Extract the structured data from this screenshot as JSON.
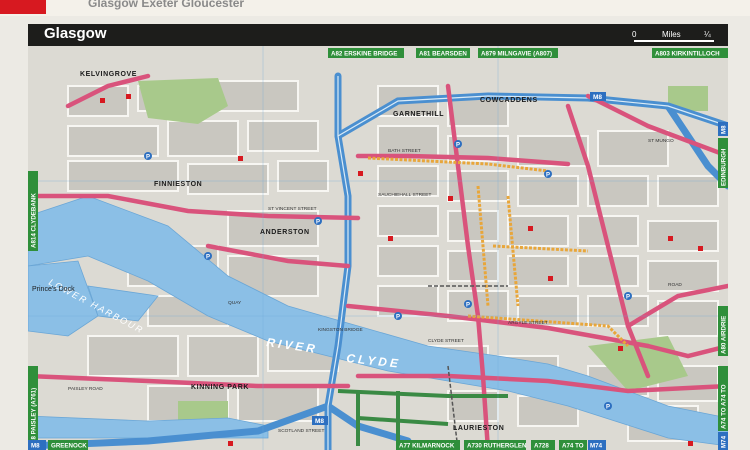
{
  "header": {
    "book_title": "Glasgow  Exeter  Gloucester",
    "map_title": "Glasgow"
  },
  "scale_bar": {
    "zero": "0",
    "unit": "Miles",
    "quarter": "¼"
  },
  "route_signs": {
    "top": [
      "A82 ERSKINE BRIDGE",
      "A81 BEARSDEN",
      "A879 MILNGAVIE (A807)",
      "A803 KIRKINTILLOCH"
    ],
    "bottom": [
      "M8",
      "GREENOCK",
      "A77 KILMARNOCK",
      "A730 RUTHERGLEN",
      "A728",
      "A74 TO",
      "M74"
    ],
    "left": [
      "A814 CLYDEBANK",
      "A8 PAISLEY (A761)"
    ],
    "right": [
      "M8",
      "EDINBURGH",
      "A80 AIRDRIE",
      "A74 TO A74 TO",
      "M74"
    ]
  },
  "districts": [
    "KELVINGROVE",
    "FINNIESTON",
    "ANDERSTON",
    "GARNETHILL",
    "COWCADDENS",
    "KINNING PARK",
    "LAURIESTON"
  ],
  "water": {
    "river": "RIVER",
    "river2": "CLYDE",
    "harbour": "LOWER HARBOUR",
    "dock": "Prince's Dock"
  },
  "motorway_shields": [
    "M8",
    "M8",
    "M8"
  ],
  "parking_symbol": "P",
  "street_labels": [
    "ST VINCENT STREET",
    "BATH STREET",
    "SCOTLAND STREET",
    "PAISLEY ROAD",
    "CLYDE STREET",
    "KINGSTON BRIDGE",
    "ARGYLE STREET",
    "SAUCHIEHALL STREET",
    "ROAD",
    "ST MUNGO",
    "QUAY"
  ],
  "colors": {
    "motorway": "#4a8fd0",
    "primary_road": "#d9537c",
    "pedestrian": "#e8a63a",
    "green_signs": "#2f8f3a",
    "water": "#8bbfe6",
    "park": "#a8c98b",
    "block": "#c9c7c0",
    "header": "#1d1d1b"
  }
}
